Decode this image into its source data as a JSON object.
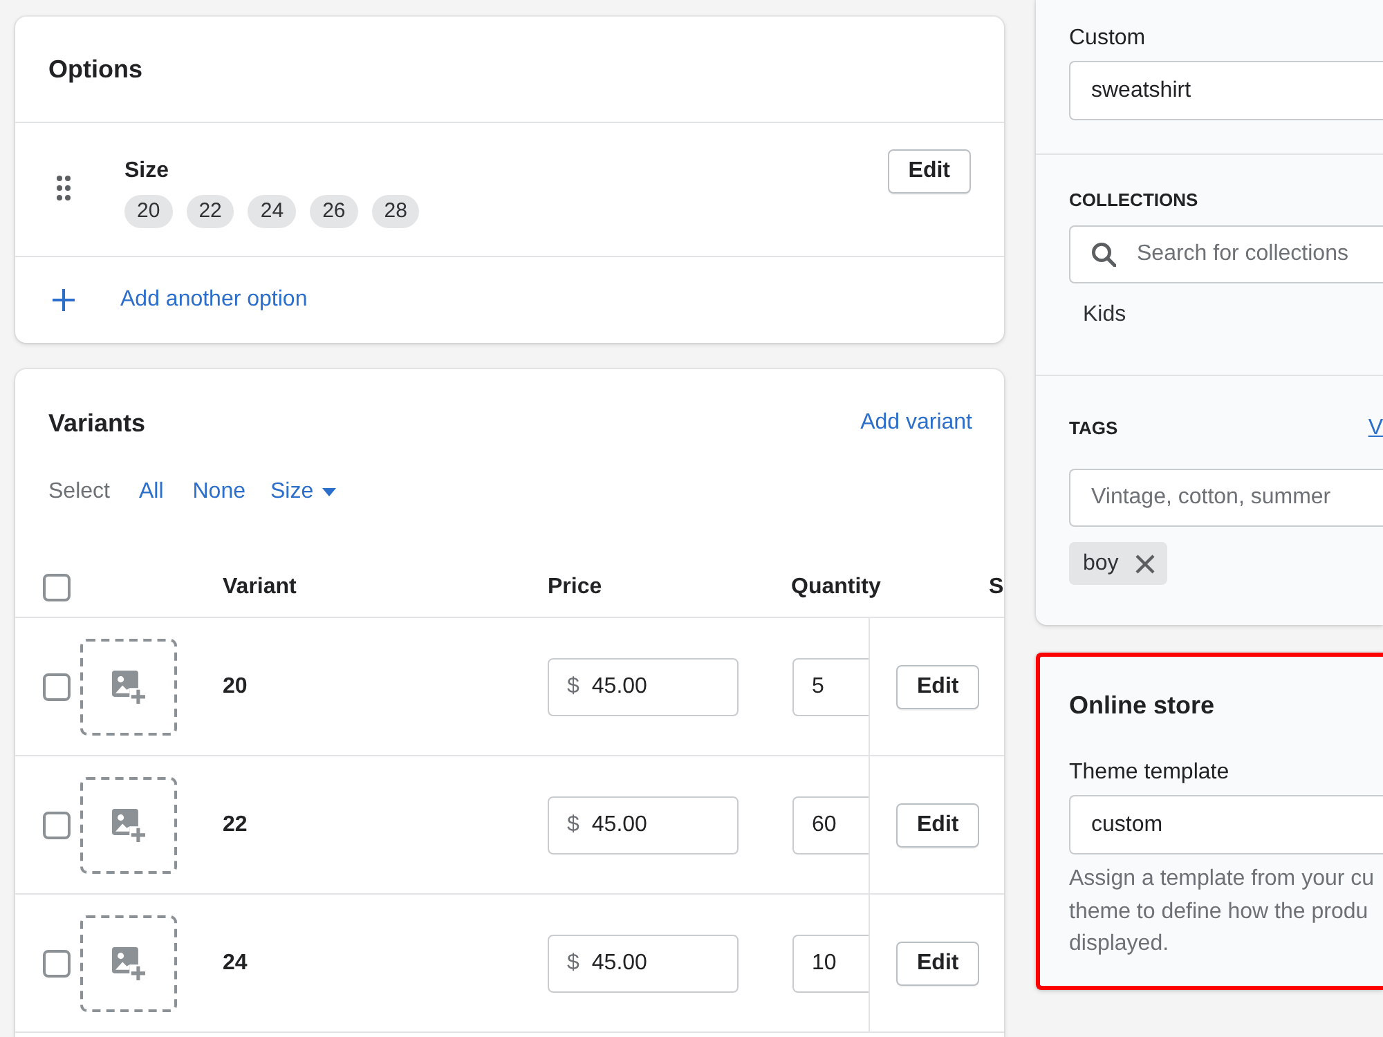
{
  "options_card": {
    "title": "Options",
    "options": [
      {
        "name": "Size",
        "values": [
          "20",
          "22",
          "24",
          "26",
          "28"
        ],
        "edit_label": "Edit"
      }
    ],
    "add_label": "Add another option"
  },
  "variants_card": {
    "title": "Variants",
    "add_link": "Add variant",
    "select": {
      "label": "Select",
      "links": [
        "All",
        "None"
      ],
      "dropdown": "Size"
    },
    "header_checked": false,
    "columns": [
      "Variant",
      "Price",
      "Quantity",
      "S"
    ],
    "rows": [
      {
        "name": "20",
        "currency": "$",
        "price": "45.00",
        "quantity": "5",
        "checked": false,
        "edit_label": "Edit"
      },
      {
        "name": "22",
        "currency": "$",
        "price": "45.00",
        "quantity": "60",
        "checked": false,
        "edit_label": "Edit"
      },
      {
        "name": "24",
        "currency": "$",
        "price": "45.00",
        "quantity": "10",
        "checked": false,
        "edit_label": "Edit"
      }
    ]
  },
  "organization_card": {
    "custom": {
      "label": "Custom",
      "value": "sweatshirt"
    },
    "collections": {
      "heading": "COLLECTIONS",
      "placeholder": "Search for collections",
      "items": [
        "Kids"
      ]
    },
    "tags": {
      "heading": "TAGS",
      "link": "V",
      "placeholder": "Vintage, cotton, summer",
      "items": [
        "boy"
      ]
    }
  },
  "online_store_card": {
    "title": "Online store",
    "highlighted": true,
    "field_label": "Theme template",
    "value": "custom",
    "help_lines": [
      "Assign a template from your cu",
      "theme to define how the produ",
      "displayed."
    ]
  }
}
